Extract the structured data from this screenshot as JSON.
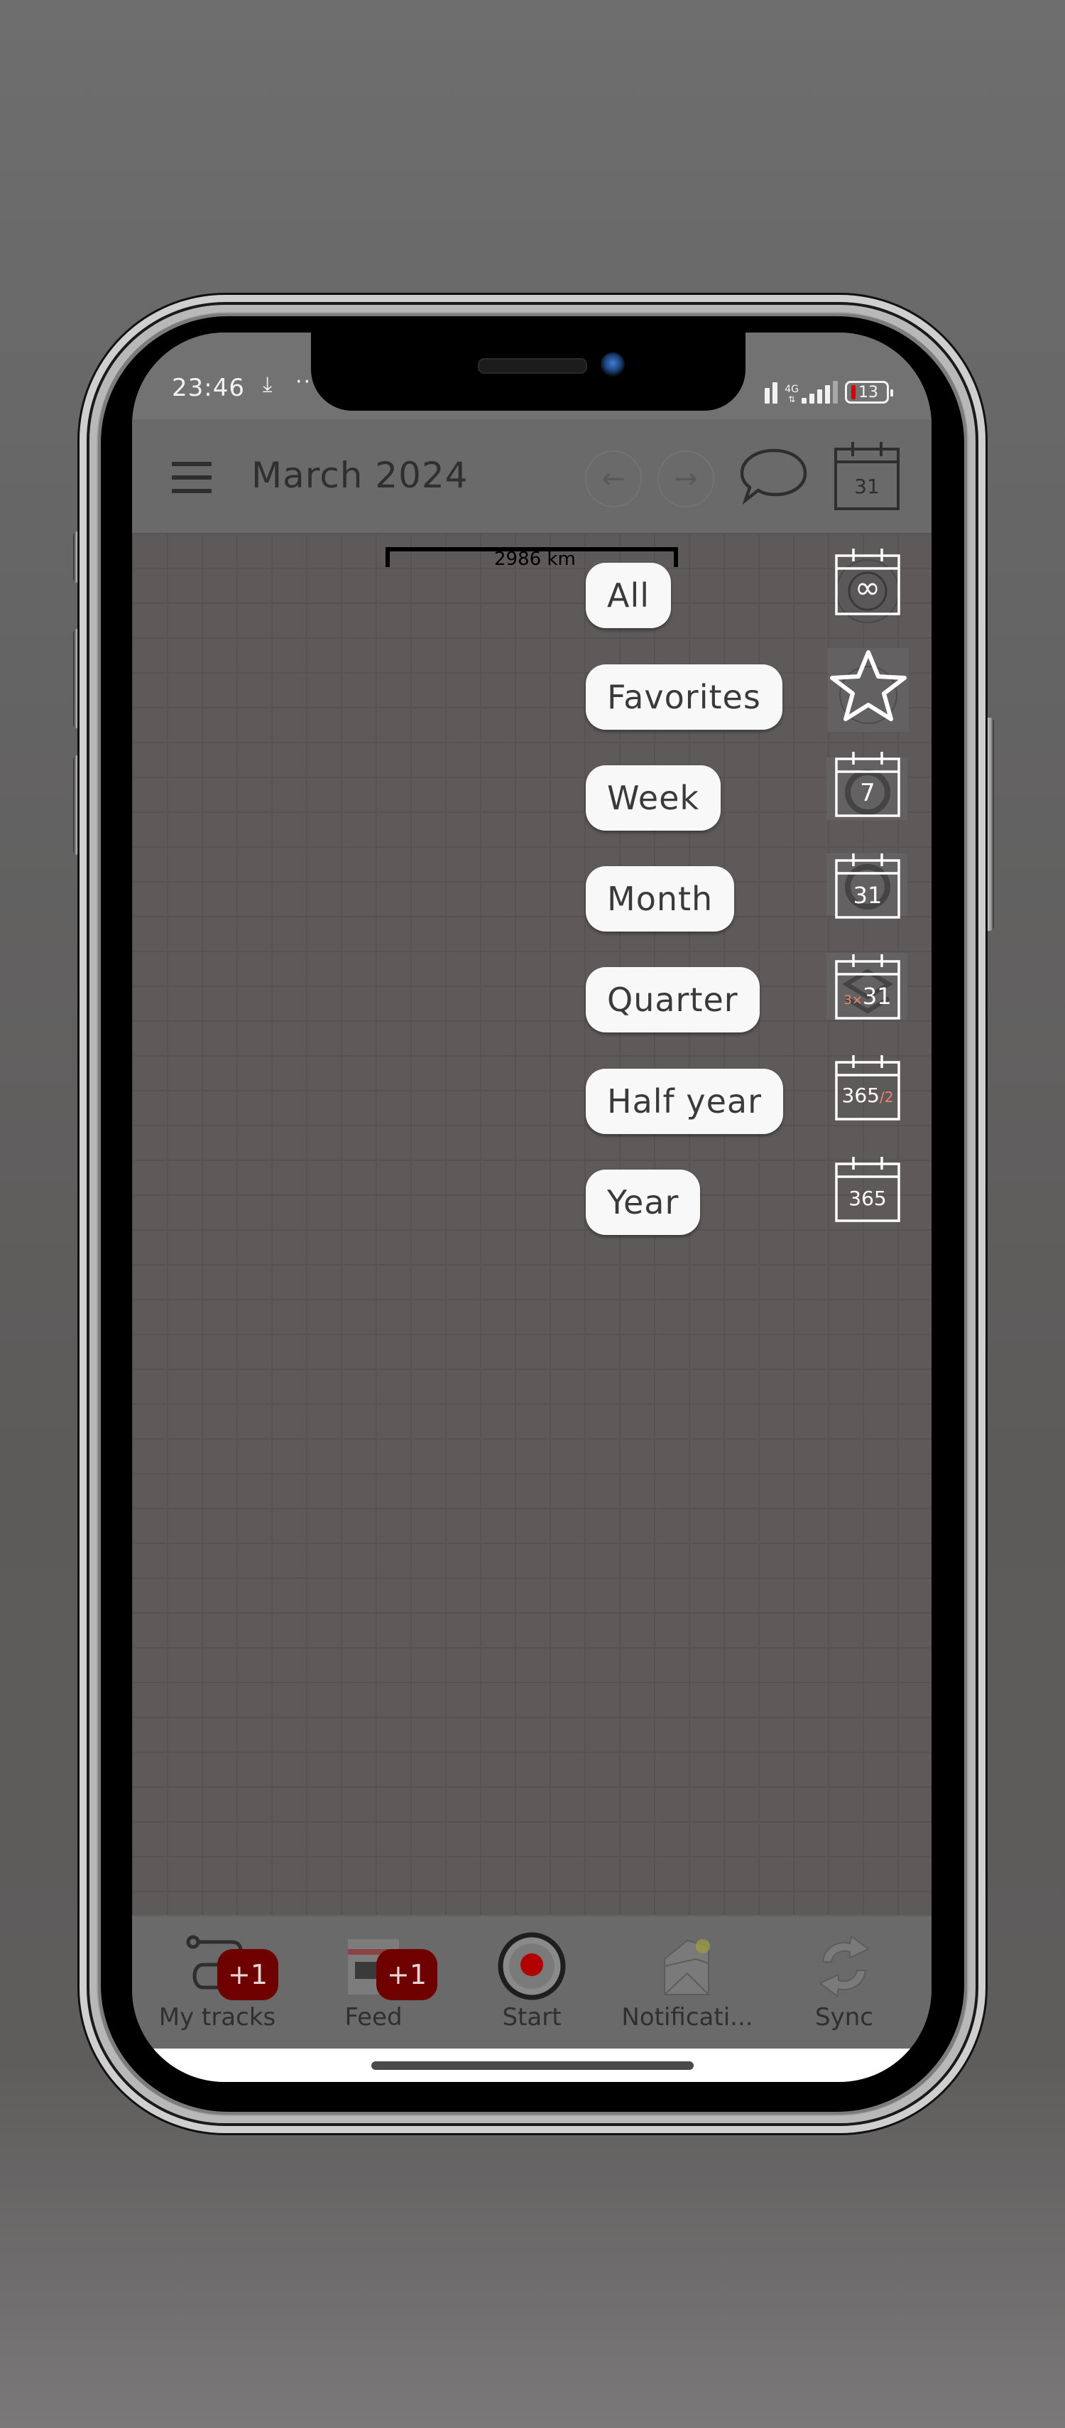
{
  "status_bar": {
    "time": "23:46",
    "download_icon": "download-icon",
    "more_dots": "··",
    "network_label": "4G",
    "battery_level": "13",
    "battery_color": "#d40000"
  },
  "app_bar": {
    "title": "March 2024",
    "back_arrow": "←",
    "forward_arrow": "→",
    "calendar_day": "31"
  },
  "map": {
    "scale_label": "2986 km"
  },
  "period_menu": {
    "items": [
      {
        "label": "All",
        "icon": "infinity-calendar-icon",
        "icon_text": "∞"
      },
      {
        "label": "Favorites",
        "icon": "star-icon",
        "icon_text": ""
      },
      {
        "label": "Week",
        "icon": "week-calendar-icon",
        "icon_text": "7"
      },
      {
        "label": "Month",
        "icon": "month-calendar-icon",
        "icon_text": "31"
      },
      {
        "label": "Quarter",
        "icon": "quarter-calendar-icon",
        "icon_text": "31",
        "icon_prefix": "3×"
      },
      {
        "label": "Half year",
        "icon": "half-year-calendar-icon",
        "icon_text": "365",
        "icon_suffix": "/2"
      },
      {
        "label": "Year",
        "icon": "year-calendar-icon",
        "icon_text": "365"
      }
    ],
    "accent_color": "#f08070"
  },
  "bottom_nav": {
    "items": [
      {
        "label": "My tracks",
        "badge": "+1"
      },
      {
        "label": "Feed",
        "badge": "+1"
      },
      {
        "label": "Start"
      },
      {
        "label": "Notificati..."
      },
      {
        "label": "Sync"
      }
    ],
    "badge_color": "#6e0000",
    "record_color": "#c00000"
  }
}
